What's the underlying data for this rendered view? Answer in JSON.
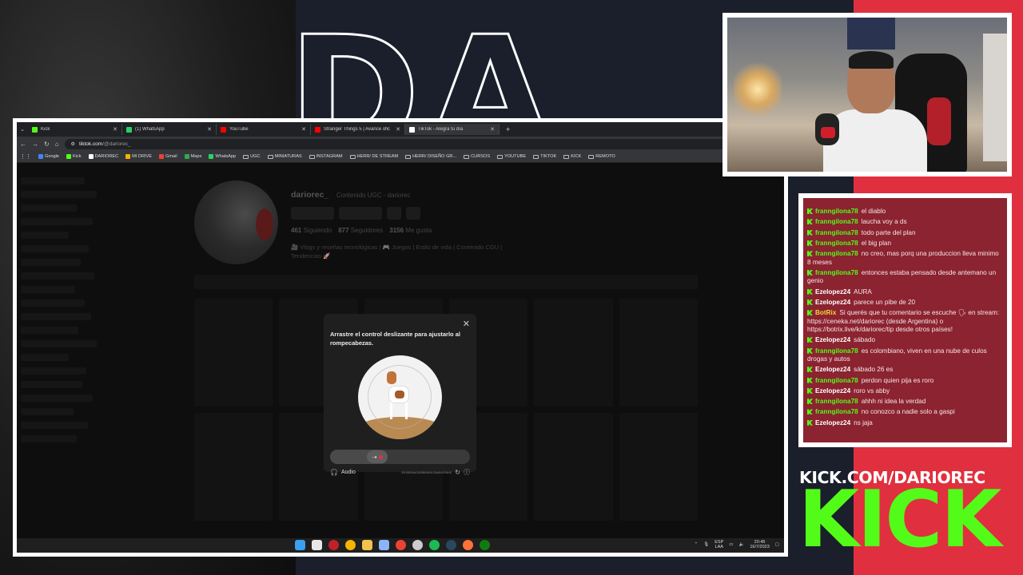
{
  "overlay": {
    "big_letters": "DA",
    "kick_url": "KICK.COM/DARIOREC",
    "kick_logo": "KICK",
    "colors": {
      "navy": "#1b1f2c",
      "red": "#e0303f",
      "kick_green": "#53fc18"
    }
  },
  "browser": {
    "tabs": [
      {
        "label": "Kick",
        "icon": "kick-icon",
        "color": "#53fc18"
      },
      {
        "label": "(1) WhatsApp",
        "icon": "whatsapp-icon",
        "color": "#25d366"
      },
      {
        "label": "YouTube",
        "icon": "youtube-icon",
        "color": "#ff0000"
      },
      {
        "label": "Stranger Things 5 | Avance ofic",
        "icon": "youtube-icon",
        "color": "#ff0000"
      },
      {
        "label": "TikTok - Alegra tu día",
        "icon": "tiktok-icon",
        "color": "#ffffff"
      }
    ],
    "address": {
      "host": "tiktok.com",
      "path": "/@dariorec_"
    },
    "bookmarks": [
      {
        "label": "Google",
        "type": "site",
        "color": "#4285f4"
      },
      {
        "label": "Kick",
        "type": "site",
        "color": "#53fc18"
      },
      {
        "label": "DARIOREC",
        "type": "site",
        "color": "#ffffff"
      },
      {
        "label": "MI DRIVE",
        "type": "site",
        "color": "#f4b400"
      },
      {
        "label": "Gmail",
        "type": "site",
        "color": "#ea4335"
      },
      {
        "label": "Maps",
        "type": "site",
        "color": "#34a853"
      },
      {
        "label": "WhatsApp",
        "type": "site",
        "color": "#25d366"
      },
      {
        "label": "UGC",
        "type": "folder"
      },
      {
        "label": "MINIATURAS",
        "type": "folder"
      },
      {
        "label": "INSTAGRAM",
        "type": "folder"
      },
      {
        "label": "HERR/ DE STREAM",
        "type": "folder"
      },
      {
        "label": "HERR/ DISEÑO GR...",
        "type": "folder"
      },
      {
        "label": "CURSOS",
        "type": "folder"
      },
      {
        "label": "YOUTUBE",
        "type": "folder"
      },
      {
        "label": "TIKTOK",
        "type": "folder"
      },
      {
        "label": "KICK",
        "type": "folder"
      },
      {
        "label": "REMOTO",
        "type": "folder"
      }
    ],
    "more_bookmarks": "»"
  },
  "profile": {
    "username": "dariorec_",
    "subtitle": "Contenido UGC - dariorec",
    "following_count": "461",
    "following_label": "Siguiendo",
    "followers_count": "877",
    "followers_label": "Seguidores",
    "likes_count": "3156",
    "likes_label": "Me gusta",
    "bio_line1": "🎥 Vlogs y reseñas tecnológicas | 🎮 Juegos | Estilo de vida | Contenido CGU |",
    "bio_line2": "Tendencias 🚀"
  },
  "captcha": {
    "title": "Arrastre el control deslizante para ajustarlo al rompecabezas.",
    "audio_label": "Audio",
    "code": "3091f983b5a02b08ffb58cf3c15da9b1f906fc09",
    "slider_progress": 0.2
  },
  "taskbar": {
    "lang1": "ESP",
    "lang2": "LAA",
    "time": "20:45",
    "date": "16/7/2023"
  },
  "chat": {
    "messages": [
      {
        "user": "franngilona78",
        "user_color": "#53fc18",
        "text": "el diablo"
      },
      {
        "user": "franngilona78",
        "user_color": "#53fc18",
        "text": "laucha voy a ds"
      },
      {
        "user": "franngilona78",
        "user_color": "#53fc18",
        "text": "todo parte del plan"
      },
      {
        "user": "franngilona78",
        "user_color": "#53fc18",
        "text": "el big plan"
      },
      {
        "user": "franngilona78",
        "user_color": "#53fc18",
        "text": "no creo, mas porq una produccion lleva minimo 8 meses"
      },
      {
        "user": "franngilona78",
        "user_color": "#53fc18",
        "text": "entonces estaba pensado desde antemano un genio"
      },
      {
        "user": "Ezelopez24",
        "user_color": "#ffffff",
        "text": "AURA"
      },
      {
        "user": "Ezelopez24",
        "user_color": "#ffffff",
        "text": "parece un pibe de 20"
      },
      {
        "user": "BotRix",
        "user_color": "#f7d33a",
        "text": "Si querés que tu comentario se escuche 🗣 en stream: https://ceneka.net/dariorec (desde Argentina) o https://botrix.live/k/dariorec/tip desde otros países!"
      },
      {
        "user": "Ezelopez24",
        "user_color": "#ffffff",
        "text": "sábado"
      },
      {
        "user": "franngilona78",
        "user_color": "#53fc18",
        "text": "es colombiano, viven en una nube de culos drogas y autos"
      },
      {
        "user": "Ezelopez24",
        "user_color": "#ffffff",
        "text": "sábado 26 es"
      },
      {
        "user": "franngilona78",
        "user_color": "#53fc18",
        "text": "perdon quien pija es roro"
      },
      {
        "user": "Ezelopez24",
        "user_color": "#ffffff",
        "text": "roro vs abby"
      },
      {
        "user": "franngilona78",
        "user_color": "#53fc18",
        "text": "ahhh ni idea la verdad"
      },
      {
        "user": "franngilona78",
        "user_color": "#53fc18",
        "text": "no conozco a nadie solo a gaspi"
      },
      {
        "user": "Ezelopez24",
        "user_color": "#ffffff",
        "text": "ns jaja"
      }
    ]
  }
}
